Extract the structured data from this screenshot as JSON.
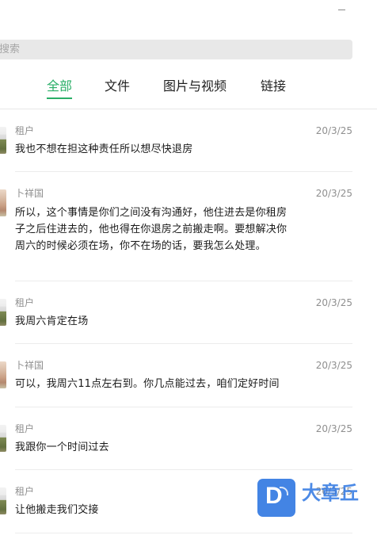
{
  "search": {
    "placeholder": "搜索"
  },
  "tabs": [
    {
      "label": "全部",
      "active": true
    },
    {
      "label": "文件",
      "active": false
    },
    {
      "label": "图片与视频",
      "active": false
    },
    {
      "label": "链接",
      "active": false
    }
  ],
  "messages": [
    {
      "avatar": "renter-avatar",
      "sender": "租户",
      "date": "20/3/25",
      "text": "我也不想在担这种责任所以想尽快退房"
    },
    {
      "avatar": "landlord-avatar",
      "sender": "卜祥国",
      "date": "20/3/25",
      "text": "所以，这个事情是你们之间没有沟通好，他住进去是你租房子之后住进去的，他也得在你退房之前搬走啊。要想解决你周六的时候必须在场，你不在场的话，要我怎么处理。"
    },
    {
      "avatar": "renter-avatar",
      "sender": "租户",
      "date": "20/3/25",
      "text": "我周六肯定在场"
    },
    {
      "avatar": "landlord-avatar",
      "sender": "卜祥国",
      "date": "20/3/25",
      "text": "可以，我周六11点左右到。你几点能过去，咱们定好时间"
    },
    {
      "avatar": "renter-avatar",
      "sender": "租户",
      "date": "20/3/25",
      "text": "我跟你一个时间过去"
    },
    {
      "avatar": "renter-avatar",
      "sender": "租户",
      "date": "20/3/25",
      "text": "让他搬走我们交接"
    }
  ],
  "watermark": {
    "text": "大章丘",
    "icon": "d-logo-icon"
  },
  "colors": {
    "accent": "#2aae67",
    "muted": "#8f8f8f",
    "text": "#1a1a1a",
    "watermark": "#2f77e2"
  }
}
